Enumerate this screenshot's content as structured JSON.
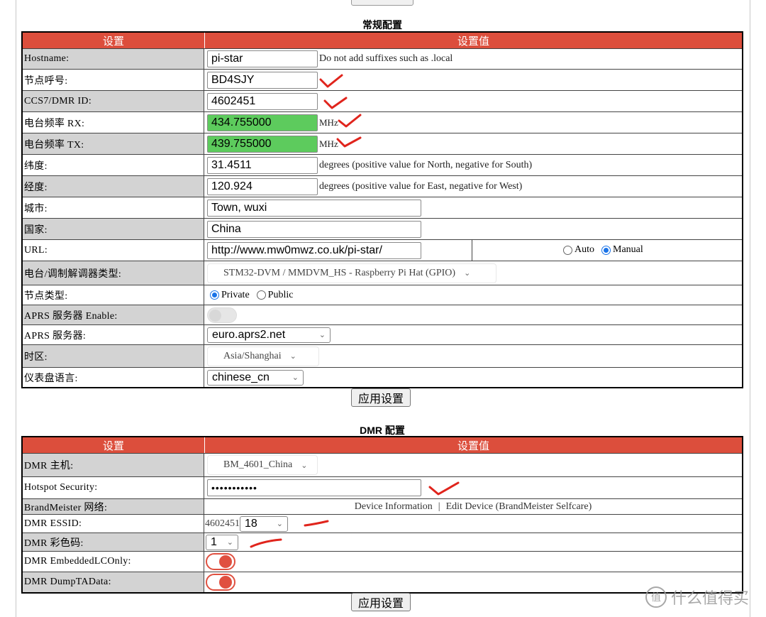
{
  "general": {
    "title": "常规配置",
    "header": {
      "setting": "设置",
      "value": "设置值"
    },
    "hostname": {
      "label": "Hostname:",
      "value": "pi-star",
      "hint": "Do not add suffixes such as .local"
    },
    "callsign": {
      "label": "节点呼号:",
      "value": "BD4SJY"
    },
    "dmr_id": {
      "label": "CCS7/DMR ID:",
      "value": "4602451"
    },
    "rx": {
      "label": "电台频率 RX:",
      "value": "434.755000",
      "unit": "MHz"
    },
    "tx": {
      "label": "电台频率 TX:",
      "value": "439.755000",
      "unit": "MHz"
    },
    "lat": {
      "label": "纬度:",
      "value": "31.4511",
      "hint": "degrees (positive value for North, negative for South)"
    },
    "lon": {
      "label": "经度:",
      "value": "120.924",
      "hint": "degrees (positive value for East, negative for West)"
    },
    "city": {
      "label": "城市:",
      "value": "Town, wuxi"
    },
    "country": {
      "label": "国家:",
      "value": "China"
    },
    "url": {
      "label": "URL:",
      "value": "http://www.mw0mwz.co.uk/pi-star/",
      "auto": "Auto",
      "manual": "Manual",
      "selected": "Manual"
    },
    "modem": {
      "label": "电台/调制解调器类型:",
      "value": "STM32-DVM / MMDVM_HS - Raspberry Pi Hat (GPIO)"
    },
    "node_type": {
      "label": "节点类型:",
      "private": "Private",
      "public": "Public",
      "selected": "Private"
    },
    "aprs_enable": {
      "label": "APRS 服务器 Enable:",
      "enabled": false
    },
    "aprs_server": {
      "label": "APRS 服务器:",
      "value": "euro.aprs2.net"
    },
    "timezone": {
      "label": "时区:",
      "value": "Asia/Shanghai"
    },
    "language": {
      "label": "仪表盘语言:",
      "value": "chinese_cn"
    },
    "apply": "应用设置"
  },
  "dmr": {
    "title": "DMR 配置",
    "header": {
      "setting": "设置",
      "value": "设置值"
    },
    "master": {
      "label": "DMR 主机:",
      "value": "BM_4601_China"
    },
    "security": {
      "label": "Hotspot Security:",
      "value": "•••••••••••"
    },
    "bm_network": {
      "label": "BrandMeister 网络:",
      "device_info": "Device Information",
      "sep": "|",
      "edit_device": "Edit Device (BrandMeister Selfcare)"
    },
    "essid": {
      "label": "DMR ESSID:",
      "prefix": "4602451",
      "value": "18"
    },
    "color_code": {
      "label": "DMR 彩色码:",
      "value": "1"
    },
    "embedded_lc": {
      "label": "DMR EmbeddedLCOnly:",
      "enabled": true
    },
    "dump_ta": {
      "label": "DMR DumpTAData:",
      "enabled": true
    },
    "apply": "应用设置"
  },
  "watermark": "什么值得买",
  "colors": {
    "header_red": "#dc4e3c",
    "freq_green": "#5dcb5d",
    "annotation_red": "#e0241c"
  }
}
